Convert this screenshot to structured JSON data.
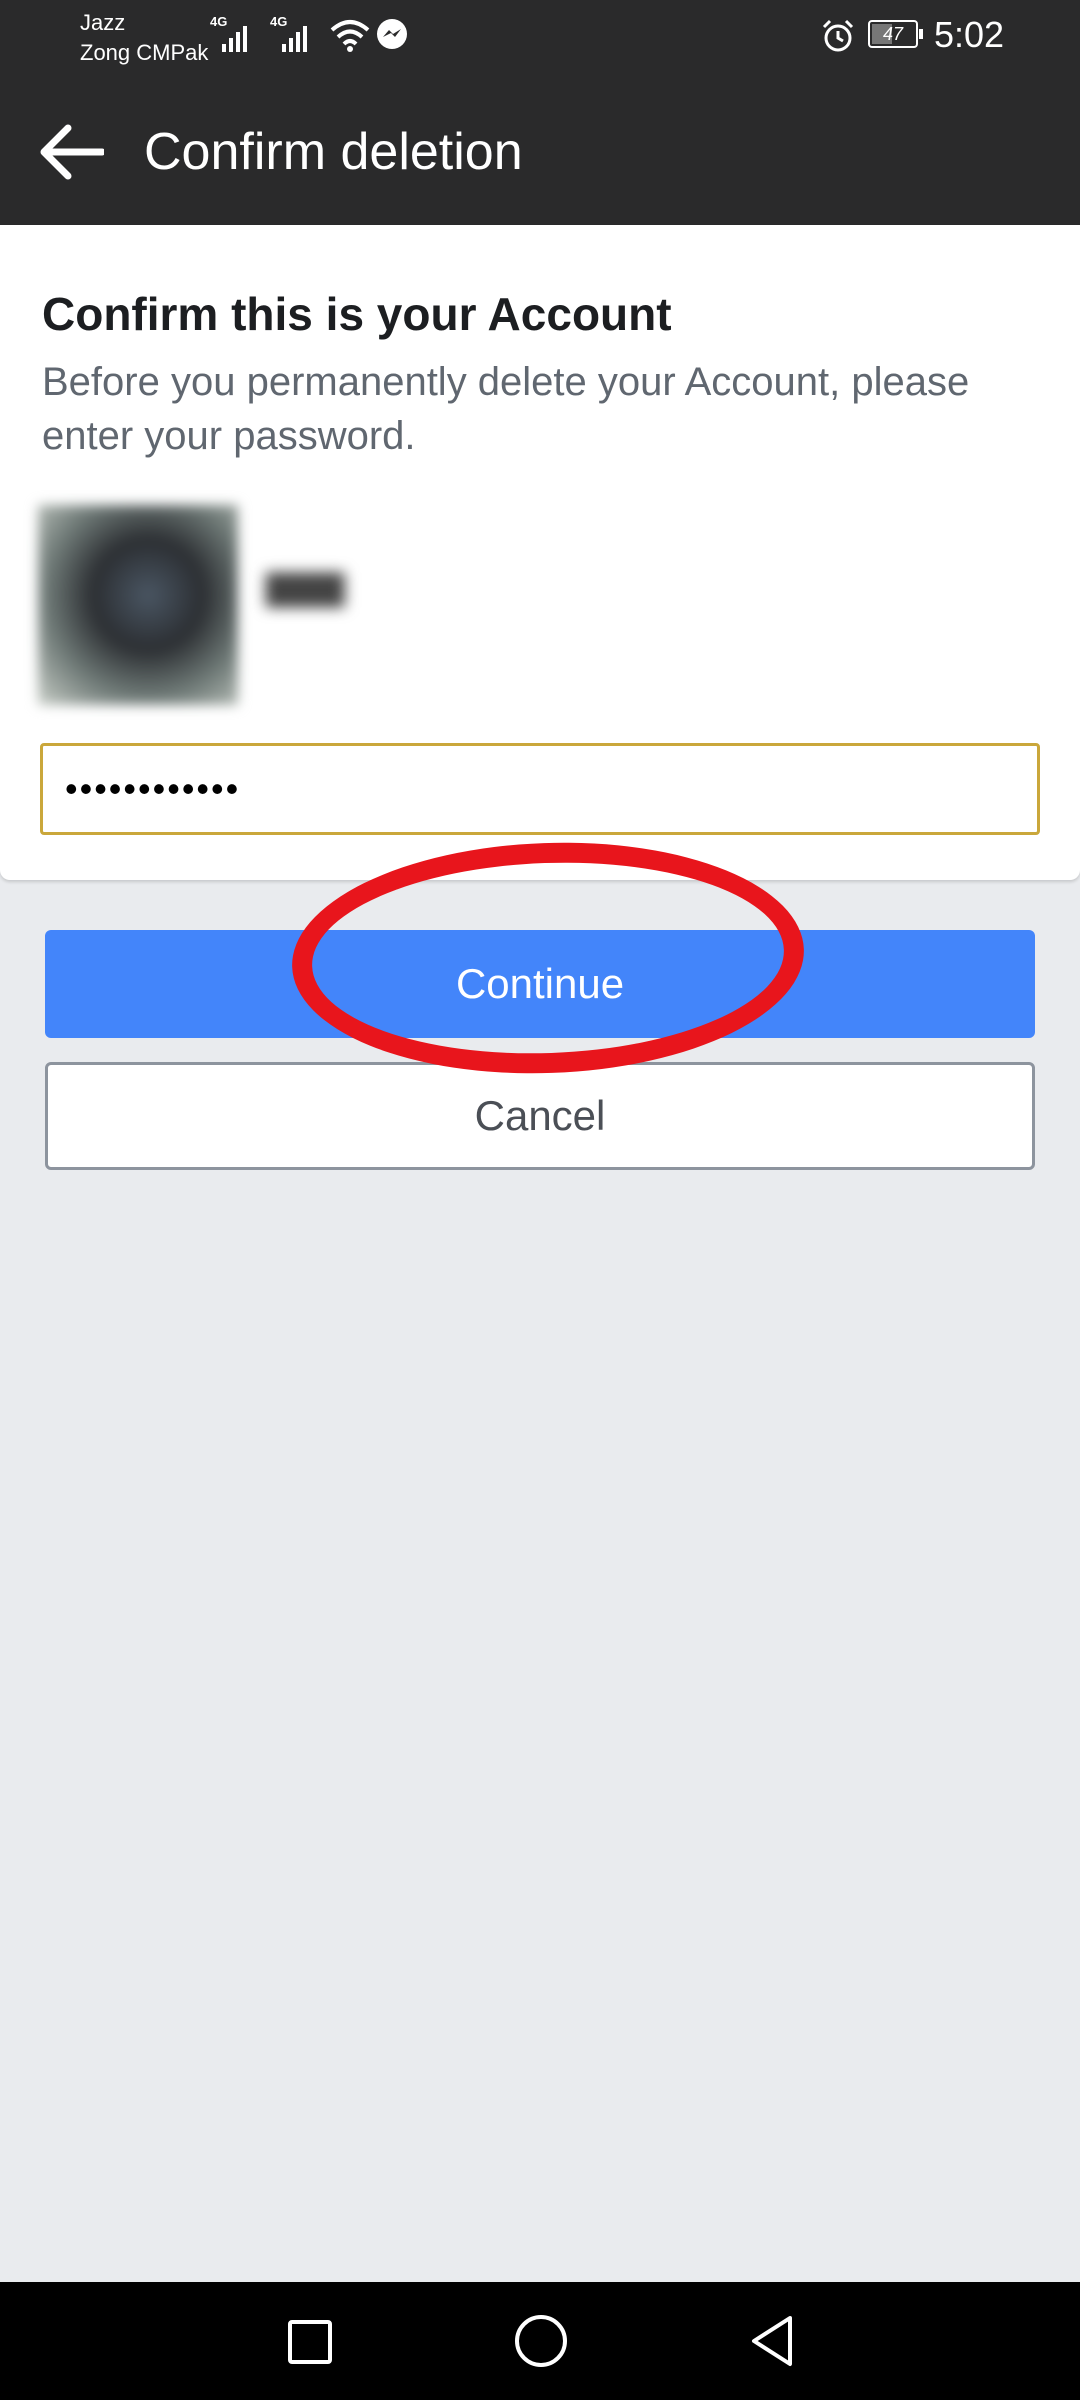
{
  "status_bar": {
    "carrier_1": "Jazz",
    "carrier_2": "Zong CMPak",
    "network_1": "4G",
    "network_2": "4G",
    "battery": "47",
    "time": "5:02",
    "icons": [
      "signal-icon",
      "wifi-icon",
      "messenger-icon",
      "alarm-icon",
      "battery-icon"
    ]
  },
  "app_bar": {
    "back_icon": "arrow-left-icon",
    "title": "Confirm deletion"
  },
  "card": {
    "title": "Confirm this is your Account",
    "description": "Before you permanently delete your Account, please enter your password.",
    "password_value": "••••••••••••"
  },
  "buttons": {
    "continue_label": "Continue",
    "cancel_label": "Cancel"
  },
  "colors": {
    "app_bar": "#2a2a2b",
    "primary": "#4385fa",
    "field_border": "#caa73b",
    "annotation": "#e8151c",
    "background": "#e9ebee"
  },
  "nav_bar": {
    "icons": [
      "recents-square-icon",
      "home-circle-icon",
      "back-triangle-icon"
    ]
  }
}
